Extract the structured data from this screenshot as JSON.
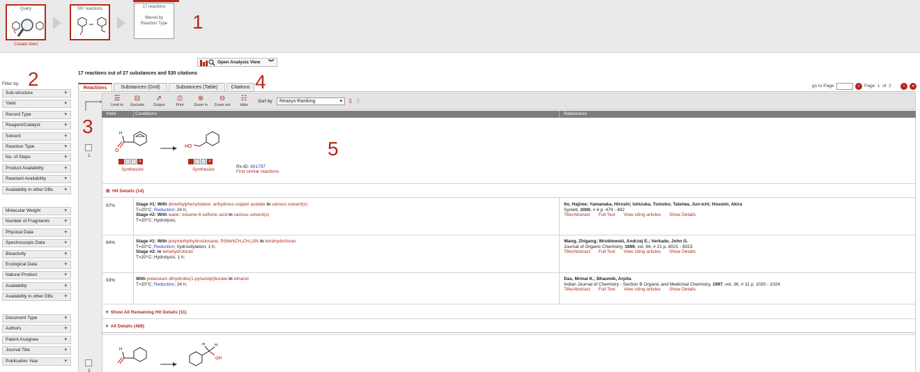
{
  "workflow": {
    "step1_caption": "Query",
    "step2_caption": "597 reactions",
    "step3_caption": "17 reactions",
    "step3_body_1": "filtered by",
    "step3_body_2": "Reaction Type",
    "create_alert": "Create Alert"
  },
  "callouts": [
    "1",
    "2",
    "3",
    "4",
    "5"
  ],
  "analysis_view": "Open Analysis View",
  "summary": "17 reactions out of 27 substances and 530 citations",
  "filter_by": "Filter by:",
  "filters_group1": [
    "Sub-structure",
    "Yield",
    "Record Type",
    "Reagent/Catalyst",
    "Solvent",
    "Reaction Type",
    "No. of Steps",
    "Product Availability",
    "Reactant Availability",
    "Availability in other DBs"
  ],
  "filters_group2": [
    "Molecular Weight",
    "Number of Fragments",
    "Physical Data",
    "Spectroscopic Data",
    "Bioactivity",
    "Ecological Data",
    "Natural Product",
    "Availability",
    "Availability in other DBs"
  ],
  "filters_group3": [
    "Document Type",
    "Authors",
    "Patent Assignee",
    "Journal Title",
    "Publication Year"
  ],
  "tabs": [
    "Reactions",
    "Substances (Grid)",
    "Substances (Table)",
    "Citations"
  ],
  "pagination": {
    "goto": "go to Page",
    "page": "Page",
    "current": "1",
    "of": "of",
    "total": "2"
  },
  "toolbar": {
    "tools": [
      "Limit to",
      "Exclude",
      "Output",
      "Print",
      "Zoom in",
      "Zoom out",
      "Hide"
    ],
    "sort_label": "Sort by",
    "sort_value": "Reaxys-Ranking"
  },
  "columns": {
    "yield": "Yield",
    "conditions": "Conditions",
    "references": "References"
  },
  "reaction1": {
    "num": "1",
    "synthesize_1": "Synthesize",
    "synthesize_2": "Synthesize",
    "rxid_label": "Rx-ID:",
    "rxid": "601797",
    "similar": "Find similar reactions",
    "hit_details": "Hit Details (14)"
  },
  "hits": [
    {
      "yield": "97%",
      "s1_prefix": "Stage #1:",
      "s1_with": "With",
      "s1_reagents": "dimethylphenylsilane; anhydrous copper acetate",
      "s1_in": "in",
      "s1_solvent": "various solvent(s)",
      "s1_line2a": "T=20°C;",
      "s1_line2b": "Reduction",
      "s1_line2c": "; 24 h;",
      "s2_prefix": "Stage #2:",
      "s2_with": "With",
      "s2_reagents": "water; toluene-4-sulfonic acid",
      "s2_in": "in",
      "s2_solvent": "various solvent(s)",
      "s2_line2": "T=20°C; Hydrolysis;",
      "authors": "Ito, Hajime; Yamanaka, Hiroshi; Ishizuka, Tomoko; Tateiwa, Jun-ichi; Hosomi, Akira",
      "journal": "Synlett,",
      "year": "2000",
      "rest": ",   # 4  p. 479 - 482"
    },
    {
      "yield": "94%",
      "s1_prefix": "Stage #1:",
      "s1_with": "With",
      "s1_reagents": "polymethylhydrosiloxane; P(MeNCH₂CH₂)3N",
      "s1_in": "in",
      "s1_solvent": "tetrahydrofuran",
      "s1_line2a": "T=20°C;",
      "s1_line2b": "Reduction",
      "s1_line2c": "; hydrosilylation; 1 h;",
      "s2_prefix": "Stage #2:",
      "s2_with": "",
      "s2_reagents": "",
      "s2_in": "in",
      "s2_solvent": "tetrahydrofuran",
      "s2_line2": "T=20°C; Hydrolysis; 1 h;",
      "authors": "Wang, Zhigang; Wroblewski, Andrzej E.; Verkade, John G.",
      "journal": "Journal of Organic Chemistry,",
      "year": "1999",
      "rest": ",   vol. 64,   # 21  p. 8021 - 8023"
    },
    {
      "yield": "93%",
      "s1_prefix": "",
      "s1_with": "With",
      "s1_reagents": "potassium dihydrobis(1-pyrazolyl)borate",
      "s1_in": "in",
      "s1_solvent": "ethanol",
      "s1_line2a": "T=20°C;",
      "s1_line2b": "Reduction",
      "s1_line2c": "; 24 h;",
      "s2_prefix": "",
      "s2_with": "",
      "s2_reagents": "",
      "s2_in": "",
      "s2_solvent": "",
      "s2_line2": "",
      "authors": "Das, Mrinal K.; Bhaumik, Arpita",
      "journal": "Indian Journal of Chemistry - Section B Organic and Medicinal Chemistry,",
      "year": "1997",
      "rest": ",   vol. 36,   # 11  p. 1020 - 1024"
    }
  ],
  "ref_links": [
    "Title/Abstract",
    "Full Text",
    "View citing articles",
    "Show Details"
  ],
  "show_remaining": "Show All Remaining Hit Details (11)",
  "all_details": "All Details (488)",
  "reaction2": {
    "num": "2"
  },
  "colors": {
    "accent": "#b5281c"
  }
}
